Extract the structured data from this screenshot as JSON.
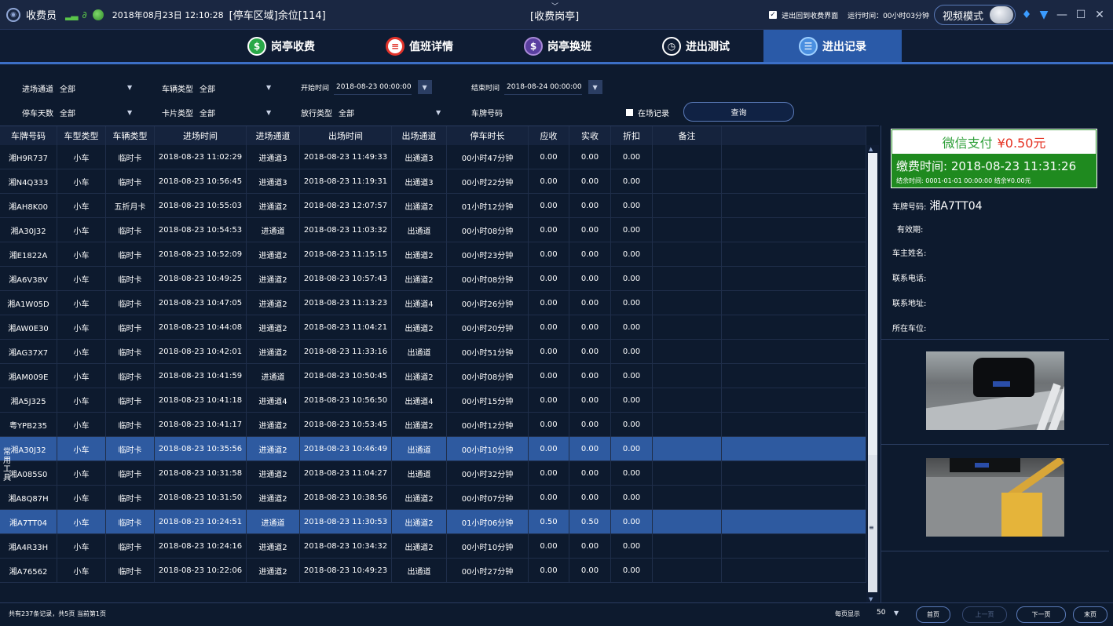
{
  "titlebar": {
    "user": "收费员",
    "datetime": "2018年08月23日 12:10:28",
    "zone": "[停车区域]余位[114]",
    "booth": "[收费岗亭]",
    "return_label": "进出回到收费界面",
    "runtime": "运行时间：00小时03分钟",
    "video_mode": "视频模式"
  },
  "nav": {
    "tabs": [
      {
        "label": "岗亭收费",
        "icon": "dollar-icon"
      },
      {
        "label": "值班详情",
        "icon": "record-icon"
      },
      {
        "label": "岗亭换班",
        "icon": "exchange-icon"
      },
      {
        "label": "进出测试",
        "icon": "clock-icon"
      },
      {
        "label": "进出记录",
        "icon": "list-icon",
        "active": true
      }
    ]
  },
  "filters": {
    "entry_lane_label": "进场通道",
    "entry_lane_value": "全部",
    "vehicle_type_label": "车辆类型",
    "vehicle_type_value": "全部",
    "start_time_label": "开始时间",
    "start_time_value": "2018-08-23 00:00:00",
    "end_time_label": "结束时间",
    "end_time_value": "2018-08-24 00:00:00",
    "park_days_label": "停车天数",
    "park_days_value": "全部",
    "card_type_label": "卡片类型",
    "card_type_value": "全部",
    "release_type_label": "放行类型",
    "release_type_value": "全部",
    "plate_label": "车牌号码",
    "in_lot_label": "在场记录",
    "query_label": "查询"
  },
  "table": {
    "headers": [
      "车牌号码",
      "车型类型",
      "车辆类型",
      "进场时间",
      "进场通道",
      "出场时间",
      "出场通道",
      "停车时长",
      "应收",
      "实收",
      "折扣",
      "备注",
      ""
    ],
    "rows": [
      [
        "湘H9R737",
        "小车",
        "临时卡",
        "2018-08-23 11:02:29",
        "进通道3",
        "2018-08-23 11:49:33",
        "出通道3",
        "00小时47分钟",
        "0.00",
        "0.00",
        "0.00",
        "",
        ""
      ],
      [
        "湘N4Q333",
        "小车",
        "临时卡",
        "2018-08-23 10:56:45",
        "进通道3",
        "2018-08-23 11:19:31",
        "出通道3",
        "00小时22分钟",
        "0.00",
        "0.00",
        "0.00",
        "",
        ""
      ],
      [
        "湘AH8K00",
        "小车",
        "五折月卡",
        "2018-08-23 10:55:03",
        "进通道2",
        "2018-08-23 12:07:57",
        "出通道2",
        "01小时12分钟",
        "0.00",
        "0.00",
        "0.00",
        "",
        ""
      ],
      [
        "湘A30J32",
        "小车",
        "临时卡",
        "2018-08-23 10:54:53",
        "进通道",
        "2018-08-23 11:03:32",
        "出通道",
        "00小时08分钟",
        "0.00",
        "0.00",
        "0.00",
        "",
        ""
      ],
      [
        "湘E1822A",
        "小车",
        "临时卡",
        "2018-08-23 10:52:09",
        "进通道2",
        "2018-08-23 11:15:15",
        "出通道2",
        "00小时23分钟",
        "0.00",
        "0.00",
        "0.00",
        "",
        ""
      ],
      [
        "湘A6V38V",
        "小车",
        "临时卡",
        "2018-08-23 10:49:25",
        "进通道2",
        "2018-08-23 10:57:43",
        "出通道2",
        "00小时08分钟",
        "0.00",
        "0.00",
        "0.00",
        "",
        ""
      ],
      [
        "湘A1W05D",
        "小车",
        "临时卡",
        "2018-08-23 10:47:05",
        "进通道2",
        "2018-08-23 11:13:23",
        "出通道4",
        "00小时26分钟",
        "0.00",
        "0.00",
        "0.00",
        "",
        ""
      ],
      [
        "湘AW0E30",
        "小车",
        "临时卡",
        "2018-08-23 10:44:08",
        "进通道2",
        "2018-08-23 11:04:21",
        "出通道2",
        "00小时20分钟",
        "0.00",
        "0.00",
        "0.00",
        "",
        ""
      ],
      [
        "湘AG37X7",
        "小车",
        "临时卡",
        "2018-08-23 10:42:01",
        "进通道2",
        "2018-08-23 11:33:16",
        "出通道",
        "00小时51分钟",
        "0.00",
        "0.00",
        "0.00",
        "",
        ""
      ],
      [
        "湘AM009E",
        "小车",
        "临时卡",
        "2018-08-23 10:41:59",
        "进通道",
        "2018-08-23 10:50:45",
        "出通道2",
        "00小时08分钟",
        "0.00",
        "0.00",
        "0.00",
        "",
        ""
      ],
      [
        "湘A5J325",
        "小车",
        "临时卡",
        "2018-08-23 10:41:18",
        "进通道4",
        "2018-08-23 10:56:50",
        "出通道4",
        "00小时15分钟",
        "0.00",
        "0.00",
        "0.00",
        "",
        ""
      ],
      [
        "粤YPB235",
        "小车",
        "临时卡",
        "2018-08-23 10:41:17",
        "进通道2",
        "2018-08-23 10:53:45",
        "出通道2",
        "00小时12分钟",
        "0.00",
        "0.00",
        "0.00",
        "",
        ""
      ],
      [
        "湘A30J32",
        "小车",
        "临时卡",
        "2018-08-23 10:35:56",
        "进通道2",
        "2018-08-23 10:46:49",
        "出通道",
        "00小时10分钟",
        "0.00",
        "0.00",
        "0.00",
        "",
        ""
      ],
      [
        "湘A085S0",
        "小车",
        "临时卡",
        "2018-08-23 10:31:58",
        "进通道2",
        "2018-08-23 11:04:27",
        "出通道",
        "00小时32分钟",
        "0.00",
        "0.00",
        "0.00",
        "",
        ""
      ],
      [
        "湘A8Q87H",
        "小车",
        "临时卡",
        "2018-08-23 10:31:50",
        "进通道2",
        "2018-08-23 10:38:56",
        "出通道2",
        "00小时07分钟",
        "0.00",
        "0.00",
        "0.00",
        "",
        ""
      ],
      [
        "湘A7TT04",
        "小车",
        "临时卡",
        "2018-08-23 10:24:51",
        "进通道",
        "2018-08-23 11:30:53",
        "出通道2",
        "01小时06分钟",
        "0.50",
        "0.50",
        "0.00",
        "",
        ""
      ],
      [
        "湘A4R33H",
        "小车",
        "临时卡",
        "2018-08-23 10:24:16",
        "进通道2",
        "2018-08-23 10:34:32",
        "出通道2",
        "00小时10分钟",
        "0.00",
        "0.00",
        "0.00",
        "",
        ""
      ],
      [
        "湘A76562",
        "小车",
        "临时卡",
        "2018-08-23 10:22:06",
        "进通道2",
        "2018-08-23 10:49:23",
        "出通道",
        "00小时27分钟",
        "0.00",
        "0.00",
        "0.00",
        "",
        ""
      ]
    ],
    "selected_rows": [
      12,
      15
    ]
  },
  "side_tool_label": "常用工具",
  "payment": {
    "method": "微信支付",
    "amount": "¥0.50元",
    "pay_time": "缴费时间: 2018-08-23 11:31:26",
    "balance": "结余时间: 0001-01-01 00:00:00 结余¥0.00元"
  },
  "details": {
    "plate_label": "车牌号码:",
    "plate_value": "湘A7TT04",
    "valid_label": "有效期:",
    "owner_label": "车主姓名:",
    "phone_label": "联系电话:",
    "address_label": "联系地址:",
    "spot_label": "所在车位:"
  },
  "bottom": {
    "summary": "共有237条记录，共5页 当前第1页",
    "page_size_label": "每页显示",
    "page_size_value": "50",
    "first": "首页",
    "prev": "上一页",
    "next": "下一页",
    "last": "末页"
  },
  "colors": {
    "background": "#0d1a2e",
    "accent": "#2a5aa8",
    "selected_row": "#2e5aa0",
    "pay_green": "#1f8a1f",
    "pay_red": "#e53020"
  }
}
